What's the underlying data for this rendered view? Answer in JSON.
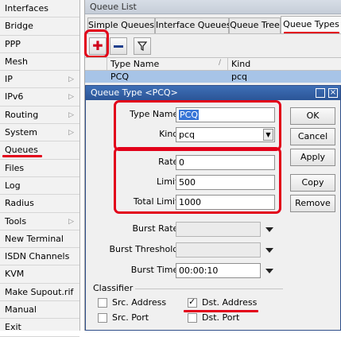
{
  "sidebar": {
    "items": [
      {
        "label": "Interfaces",
        "submenu": false
      },
      {
        "label": "Bridge",
        "submenu": false
      },
      {
        "label": "PPP",
        "submenu": false
      },
      {
        "label": "Mesh",
        "submenu": false
      },
      {
        "label": "IP",
        "submenu": true
      },
      {
        "label": "IPv6",
        "submenu": true
      },
      {
        "label": "Routing",
        "submenu": true
      },
      {
        "label": "System",
        "submenu": true
      },
      {
        "label": "Queues",
        "submenu": false
      },
      {
        "label": "Files",
        "submenu": false
      },
      {
        "label": "Log",
        "submenu": false
      },
      {
        "label": "Radius",
        "submenu": false
      },
      {
        "label": "Tools",
        "submenu": true
      },
      {
        "label": "New Terminal",
        "submenu": false
      },
      {
        "label": "ISDN Channels",
        "submenu": false
      },
      {
        "label": "KVM",
        "submenu": false
      },
      {
        "label": "Make Supout.rif",
        "submenu": false
      },
      {
        "label": "Manual",
        "submenu": false
      },
      {
        "label": "Exit",
        "submenu": false
      }
    ]
  },
  "queue_list": {
    "title": "Queue List",
    "tabs": [
      "Simple Queues",
      "Interface Queues",
      "Queue Tree",
      "Queue Types"
    ],
    "active_tab": "Queue Types",
    "toolbar": {
      "add_icon": "plus-icon",
      "remove_icon": "minus-icon",
      "filter_icon": "filter-icon"
    },
    "columns": [
      "Type Name",
      "Kind"
    ],
    "rows": [
      {
        "type_name": "PCQ",
        "kind": "pcq"
      }
    ]
  },
  "dialog": {
    "title": "Queue Type <PCQ>",
    "fields": {
      "type_name": {
        "label": "Type Name:",
        "value": "PCQ"
      },
      "kind": {
        "label": "Kind:",
        "value": "pcq"
      },
      "rate": {
        "label": "Rate:",
        "value": "0"
      },
      "limit": {
        "label": "Limit:",
        "value": "500"
      },
      "total_limit": {
        "label": "Total Limit:",
        "value": "1000"
      },
      "burst_rate": {
        "label": "Burst Rate:",
        "value": ""
      },
      "burst_threshold": {
        "label": "Burst Threshold:",
        "value": ""
      },
      "burst_time": {
        "label": "Burst Time:",
        "value": "00:00:10"
      }
    },
    "classifier": {
      "heading": "Classifier",
      "options": [
        {
          "label": "Src. Address",
          "checked": false
        },
        {
          "label": "Dst. Address",
          "checked": true
        },
        {
          "label": "Src. Port",
          "checked": false
        },
        {
          "label": "Dst. Port",
          "checked": false
        }
      ]
    },
    "buttons": {
      "ok": "OK",
      "cancel": "Cancel",
      "apply": "Apply",
      "copy": "Copy",
      "remove": "Remove"
    }
  },
  "annotation_color": "#e2001a",
  "selection_color": "#a7c4e7"
}
